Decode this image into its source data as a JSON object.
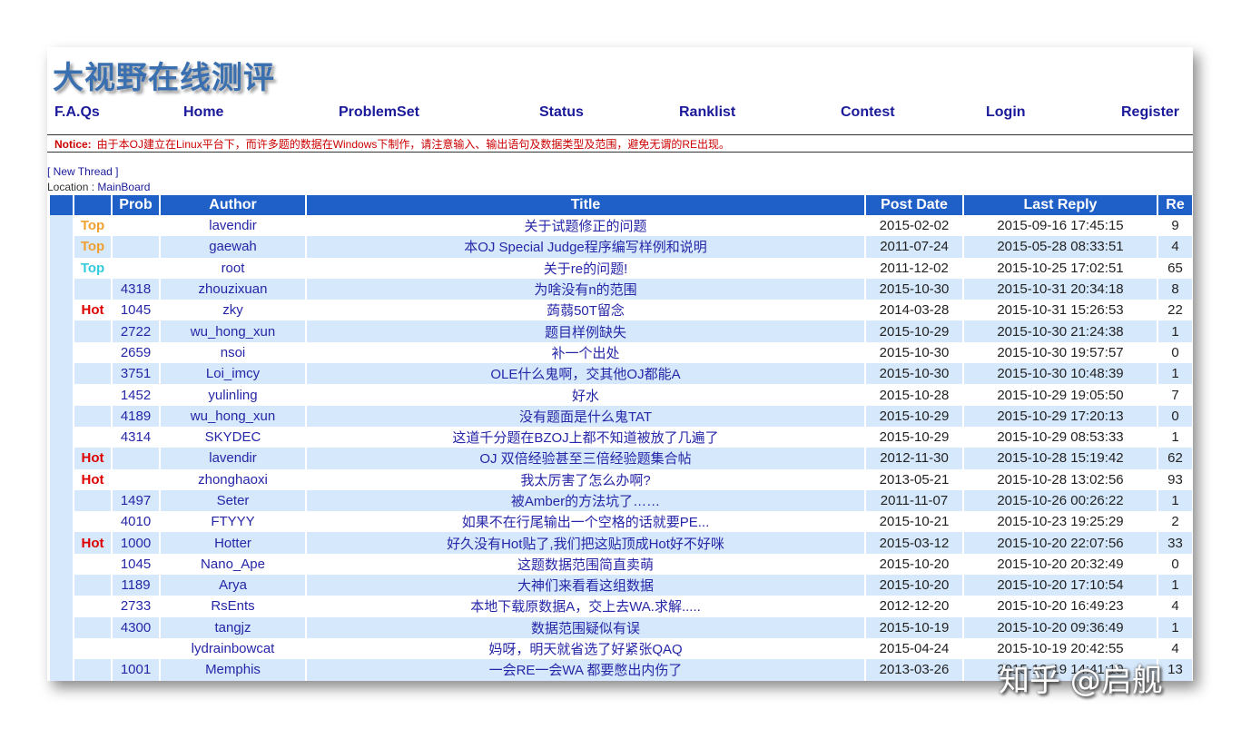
{
  "logo": "大视野在线测评",
  "nav": [
    "F.A.Qs",
    "Home",
    "ProblemSet",
    "Status",
    "Ranklist",
    "Contest",
    "Login",
    "Register"
  ],
  "notice": {
    "label": "Notice:",
    "text": "由于本OJ建立在Linux平台下，而许多题的数据在Windows下制作，请注意输入、输出语句及数据类型及范围，避免无谓的RE出现。"
  },
  "new_thread": "[ New Thread ]",
  "location_label": "Location : ",
  "location": "MainBoard",
  "columns": [
    "",
    "",
    "Prob",
    "Author",
    "Title",
    "Post Date",
    "Last Reply",
    "Re"
  ],
  "colors": {
    "top_orange": "#f0a030",
    "top_cyan": "#33ccdd",
    "hot": "#dd0000",
    "header": "#1f5fc8"
  },
  "rows": [
    [
      "Top",
      "",
      "lavendir",
      "关于试题修正的问题",
      "2015-02-02",
      "2015-09-16 17:45:15",
      "9"
    ],
    [
      "Top",
      "",
      "gaewah",
      "本OJ Special Judge程序编写样例和说明",
      "2011-07-24",
      "2015-05-28 08:33:51",
      "4"
    ],
    [
      "Top",
      "",
      "root",
      "关于re的问题!",
      "2011-12-02",
      "2015-10-25 17:02:51",
      "65"
    ],
    [
      "",
      "4318",
      "zhouzixuan",
      "为啥没有n的范围",
      "2015-10-30",
      "2015-10-31 20:34:18",
      "8"
    ],
    [
      "Hot",
      "1045",
      "zky",
      "蒟蒻50T留念",
      "2014-03-28",
      "2015-10-31 15:26:53",
      "22"
    ],
    [
      "",
      "2722",
      "wu_hong_xun",
      "题目样例缺失",
      "2015-10-29",
      "2015-10-30 21:24:38",
      "1"
    ],
    [
      "",
      "2659",
      "nsoi",
      "补一个出处",
      "2015-10-30",
      "2015-10-30 19:57:57",
      "0"
    ],
    [
      "",
      "3751",
      "Loi_imcy",
      "OLE什么鬼啊，交其他OJ都能A",
      "2015-10-30",
      "2015-10-30 10:48:39",
      "1"
    ],
    [
      "",
      "1452",
      "yulinling",
      "好水",
      "2015-10-28",
      "2015-10-29 19:05:50",
      "7"
    ],
    [
      "",
      "4189",
      "wu_hong_xun",
      "没有题面是什么鬼TAT",
      "2015-10-29",
      "2015-10-29 17:20:13",
      "0"
    ],
    [
      "",
      "4314",
      "SKYDEC",
      "这道千分题在BZOJ上都不知道被放了几遍了",
      "2015-10-29",
      "2015-10-29 08:53:33",
      "1"
    ],
    [
      "Hot",
      "",
      "lavendir",
      "OJ 双倍经验甚至三倍经验题集合帖",
      "2012-11-30",
      "2015-10-28 15:19:42",
      "62"
    ],
    [
      "Hot",
      "",
      "zhonghaoxi",
      "我太厉害了怎么办啊?",
      "2013-05-21",
      "2015-10-28 13:02:56",
      "93"
    ],
    [
      "",
      "1497",
      "Seter",
      "被Amber的方法坑了……",
      "2011-11-07",
      "2015-10-26 00:26:22",
      "1"
    ],
    [
      "",
      "4010",
      "FTYYY",
      "如果不在行尾输出一个空格的话就要PE...",
      "2015-10-21",
      "2015-10-23 19:25:29",
      "2"
    ],
    [
      "Hot",
      "1000",
      "Hotter",
      "好久没有Hot贴了,我们把这贴顶成Hot好不好咪",
      "2015-03-12",
      "2015-10-20 22:07:56",
      "33"
    ],
    [
      "",
      "1045",
      "Nano_Ape",
      "这题数据范围简直卖萌",
      "2015-10-20",
      "2015-10-20 20:32:49",
      "0"
    ],
    [
      "",
      "1189",
      "Arya",
      "大神们来看看这组数据",
      "2015-10-20",
      "2015-10-20 17:10:54",
      "1"
    ],
    [
      "",
      "2733",
      "RsEnts",
      "本地下载原数据A，交上去WA.求解.....",
      "2012-12-20",
      "2015-10-20 16:49:23",
      "4"
    ],
    [
      "",
      "4300",
      "tangjz",
      "数据范围疑似有误",
      "2015-10-19",
      "2015-10-20 09:36:49",
      "1"
    ],
    [
      "",
      "",
      "lydrainbowcat",
      "妈呀，明天就省选了好紧张QAQ",
      "2015-04-24",
      "2015-10-19 20:42:55",
      "4"
    ],
    [
      "",
      "1001",
      "Memphis",
      "一会RE一会WA 都要憋出内伤了",
      "2013-03-26",
      "2015-10-19 14:41:10",
      "13"
    ]
  ],
  "watermark": "知乎 @启舰"
}
